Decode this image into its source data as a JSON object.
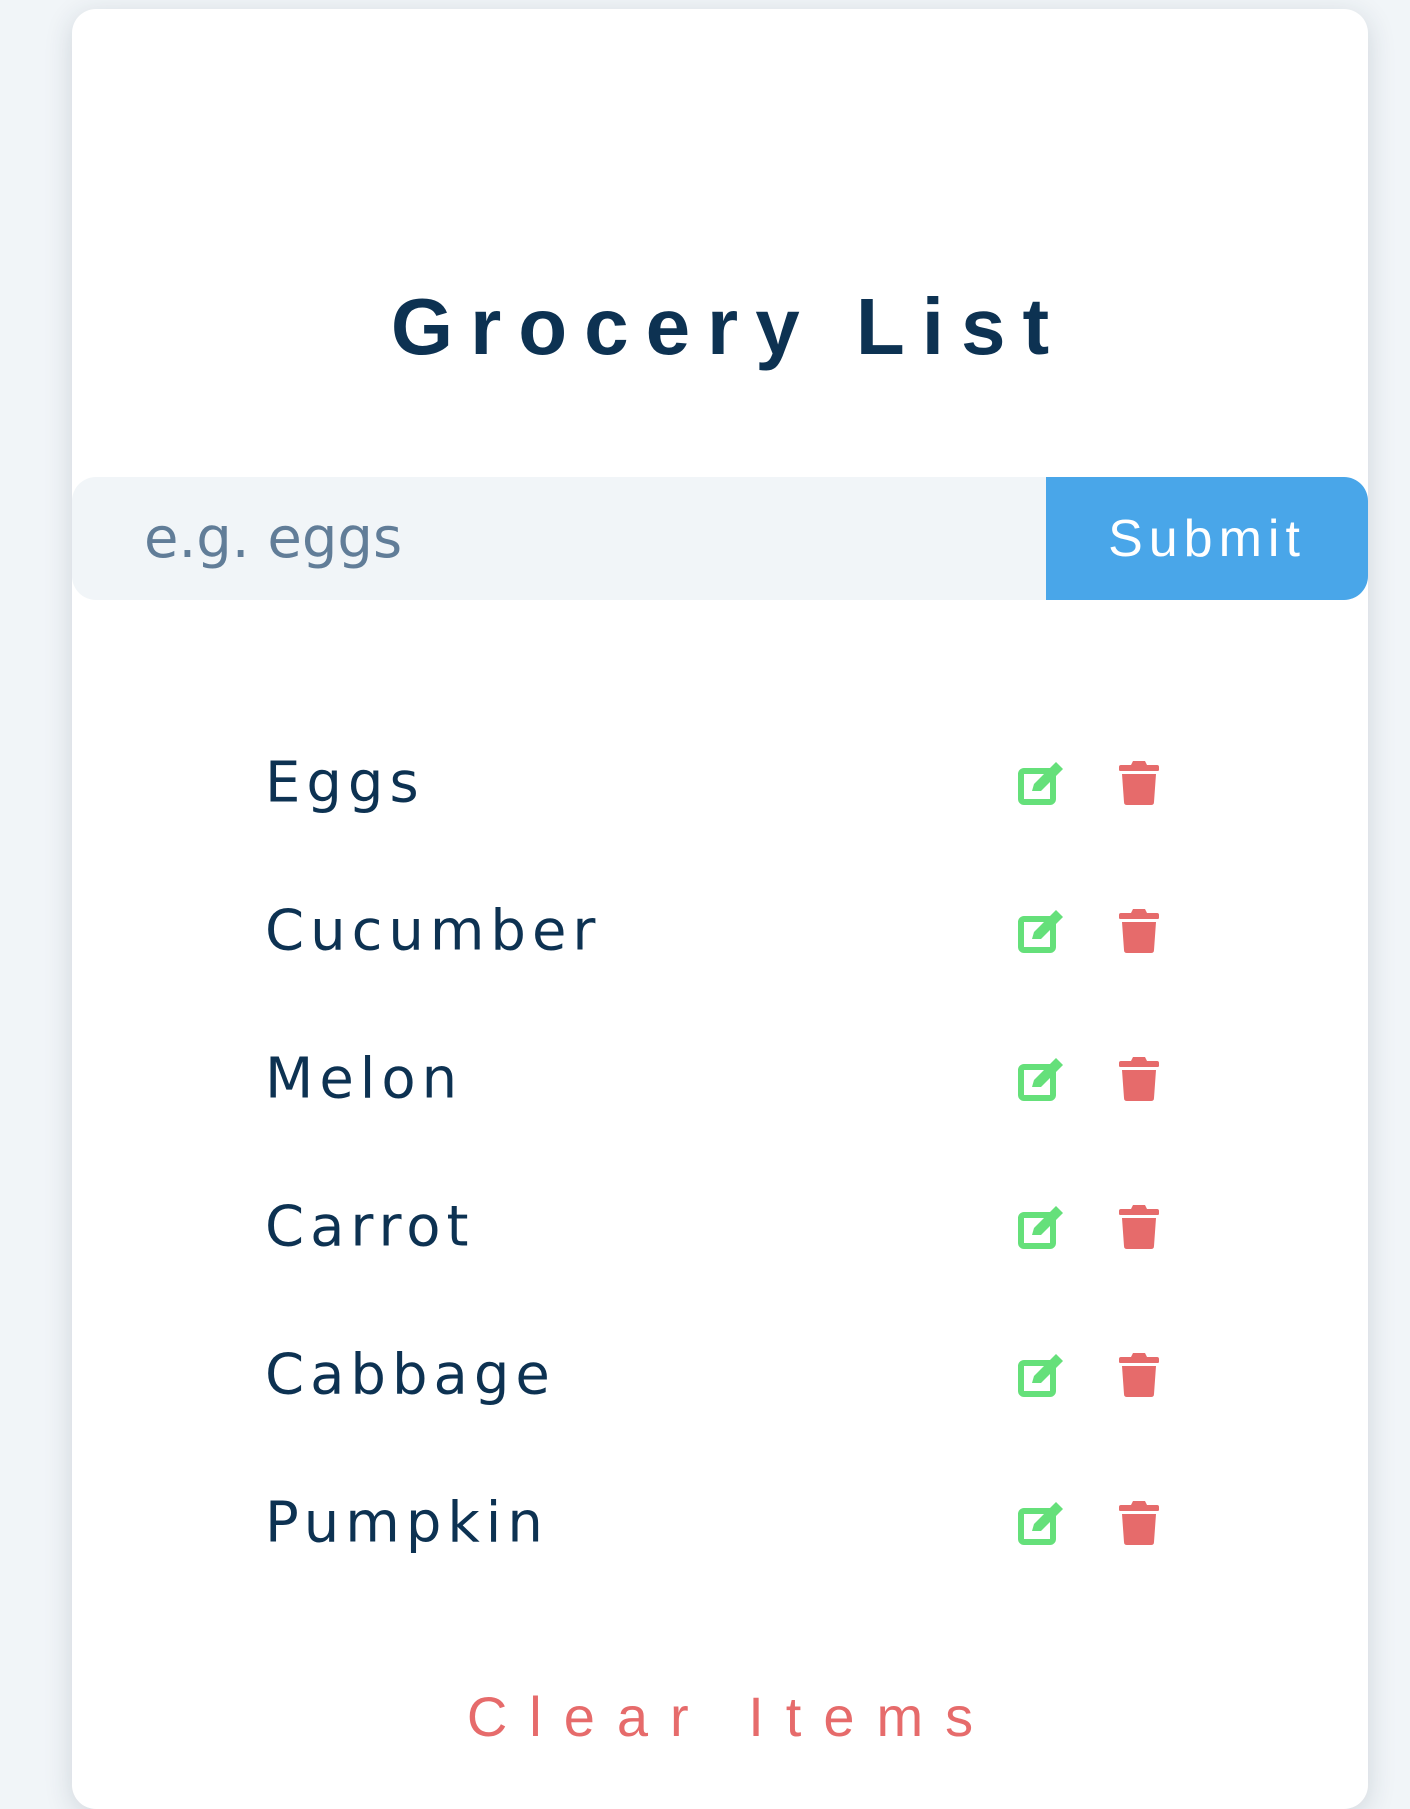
{
  "title": "Grocery List",
  "form": {
    "placeholder": "e.g. eggs",
    "value": "",
    "submit_label": "Submit"
  },
  "items": [
    {
      "name": "Eggs",
      "edit_icon": "edit-icon",
      "delete_icon": "trash-icon"
    },
    {
      "name": "Cucumber",
      "edit_icon": "edit-icon",
      "delete_icon": "trash-icon"
    },
    {
      "name": "Melon",
      "edit_icon": "edit-icon",
      "delete_icon": "trash-icon"
    },
    {
      "name": "Carrot",
      "edit_icon": "edit-icon",
      "delete_icon": "trash-icon"
    },
    {
      "name": "Cabbage",
      "edit_icon": "edit-icon",
      "delete_icon": "trash-icon"
    },
    {
      "name": "Pumpkin",
      "edit_icon": "edit-icon",
      "delete_icon": "trash-icon"
    }
  ],
  "clear_label": "Clear Items",
  "colors": {
    "title": "#0d3252",
    "accent_blue": "#49a6e9",
    "edit_green": "#65e07a",
    "delete_red": "#e66b6b",
    "input_bg": "#f1f5f8"
  }
}
